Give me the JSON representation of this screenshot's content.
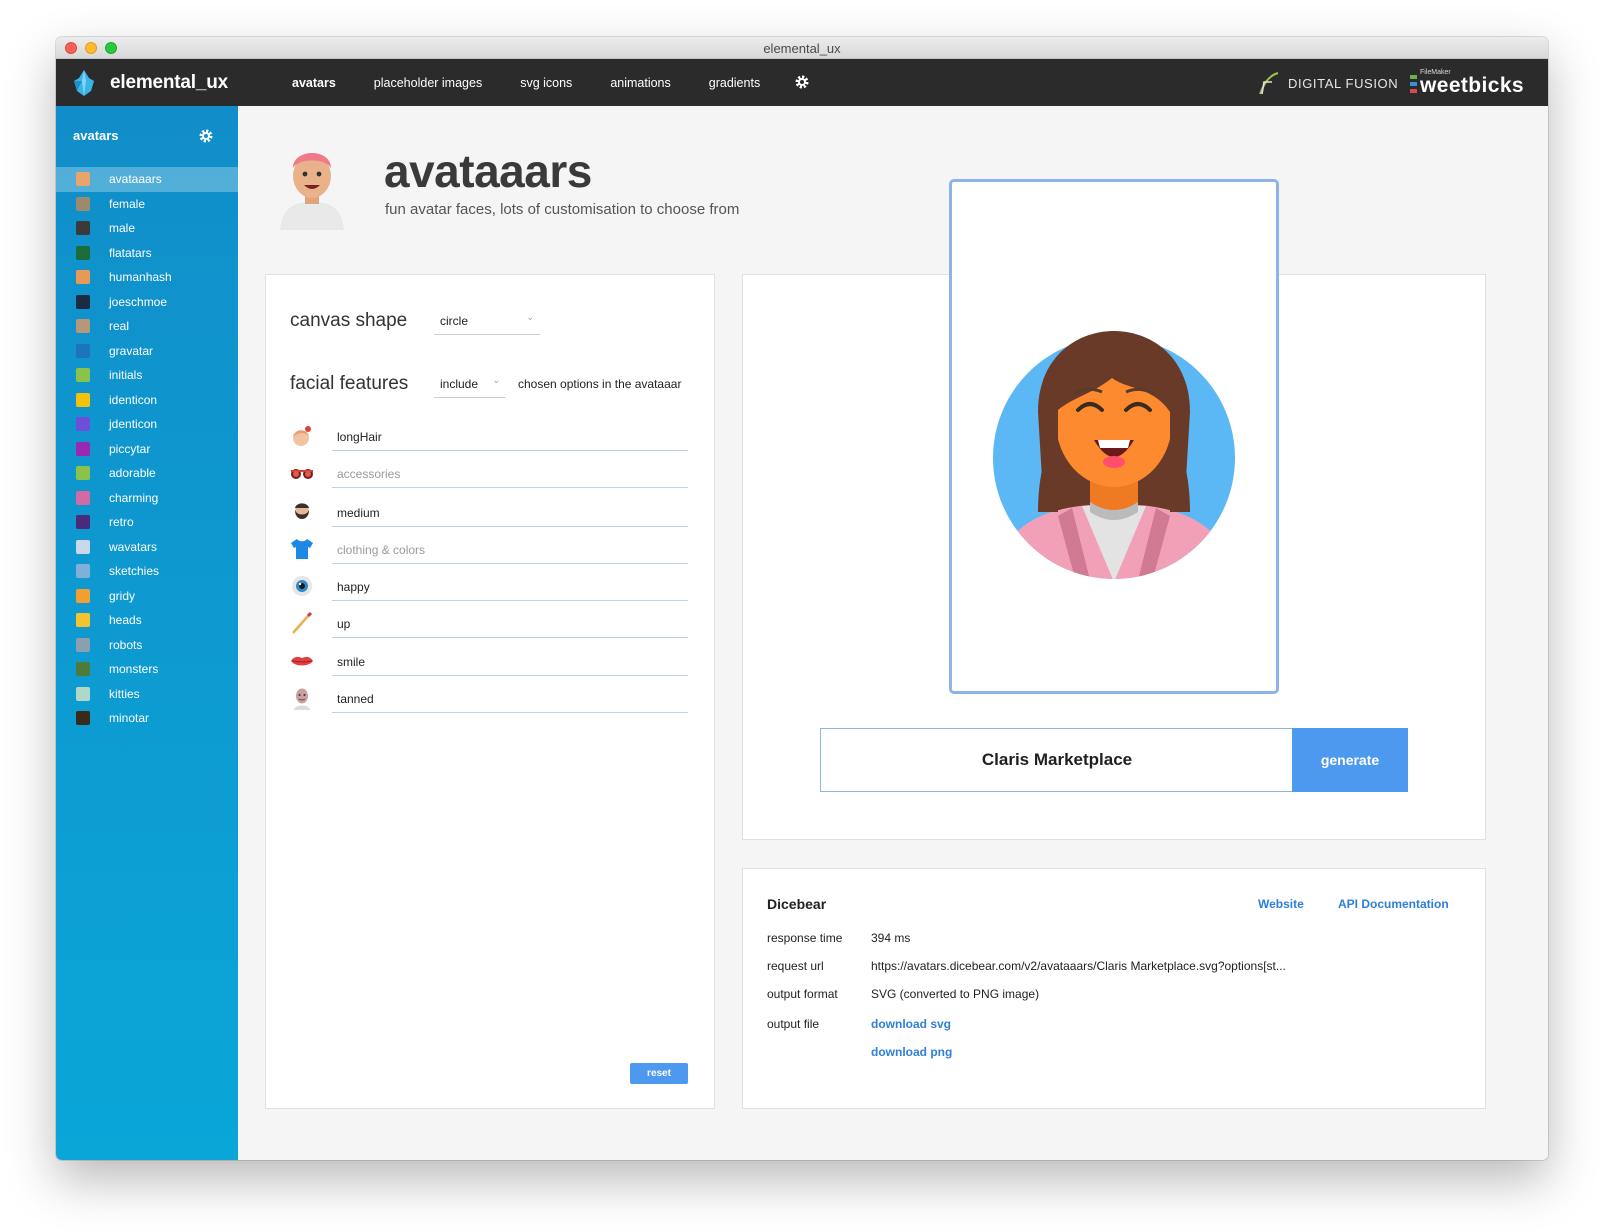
{
  "window": {
    "title": "elemental_ux"
  },
  "topnav": {
    "brand": "elemental_ux",
    "items": [
      "avatars",
      "placeholder images",
      "svg icons",
      "animations",
      "gradients"
    ],
    "partner1": "DIGITAL FUSION",
    "partner2_small": "FileMaker",
    "partner2": "weetbicks"
  },
  "sidebar": {
    "header": "avatars",
    "items": [
      {
        "label": "avataaars",
        "color": "#e8a46a"
      },
      {
        "label": "female",
        "color": "#9b8a6b"
      },
      {
        "label": "male",
        "color": "#3a3a3a"
      },
      {
        "label": "flatatars",
        "color": "#1c6b3a"
      },
      {
        "label": "humanhash",
        "color": "#e79a56"
      },
      {
        "label": "joeschmoe",
        "color": "#1b2b44"
      },
      {
        "label": "real",
        "color": "#b69878"
      },
      {
        "label": "gravatar",
        "color": "#1e73be"
      },
      {
        "label": "initials",
        "color": "#8bc34a"
      },
      {
        "label": "identicon",
        "color": "#f4c20d"
      },
      {
        "label": "jdenticon",
        "color": "#6c4fd8"
      },
      {
        "label": "piccytar",
        "color": "#9c27b0"
      },
      {
        "label": "adorable",
        "color": "#8bc34a"
      },
      {
        "label": "charming",
        "color": "#d46aa3"
      },
      {
        "label": "retro",
        "color": "#4a2a7a"
      },
      {
        "label": "wavatars",
        "color": "#c9d8e8"
      },
      {
        "label": "sketchies",
        "color": "#7fb0d8"
      },
      {
        "label": "gridy",
        "color": "#f0a030"
      },
      {
        "label": "heads",
        "color": "#f4c430"
      },
      {
        "label": "robots",
        "color": "#8aa0b0"
      },
      {
        "label": "monsters",
        "color": "#4e7a3a"
      },
      {
        "label": "kitties",
        "color": "#b0d8c8"
      },
      {
        "label": "minotar",
        "color": "#3a2a1a"
      }
    ]
  },
  "header": {
    "title": "avataaars",
    "subtitle": "fun avatar faces, lots of customisation to choose from"
  },
  "options": {
    "canvas_shape_label": "canvas shape",
    "canvas_shape_value": "circle",
    "facial_features_label": "facial features",
    "facial_features_value": "include",
    "facial_features_suffix": "chosen options in the avataaar",
    "features": [
      {
        "value": "longHair",
        "placeholder": false
      },
      {
        "value": "accessories",
        "placeholder": true
      },
      {
        "value": "medium",
        "placeholder": false
      },
      {
        "value": "clothing & colors",
        "placeholder": true
      },
      {
        "value": "happy",
        "placeholder": false
      },
      {
        "value": "up",
        "placeholder": false
      },
      {
        "value": "smile",
        "placeholder": false
      },
      {
        "value": "tanned",
        "placeholder": false
      }
    ],
    "reset_label": "reset"
  },
  "generator": {
    "seed": "Claris Marketplace",
    "button": "generate"
  },
  "info": {
    "title": "Dicebear",
    "link_website": "Website",
    "link_api": "API Documentation",
    "response_time_label": "response time",
    "response_time": "394 ms",
    "request_url_label": "request url",
    "request_url": "https://avatars.dicebear.com/v2/avataaars/Claris Marketplace.svg?options[st...",
    "output_format_label": "output format",
    "output_format": "SVG (converted to PNG image)",
    "output_file_label": "output file",
    "download_svg": "download svg",
    "download_png": "download png"
  },
  "colors": {
    "accent": "#4d99f0",
    "sidebar_top": "#118ec9",
    "sidebar_bottom": "#0aa6d8",
    "avatar_bg": "#5bb8f5",
    "skin": "#fd8a2e",
    "hair": "#6a3a28"
  }
}
